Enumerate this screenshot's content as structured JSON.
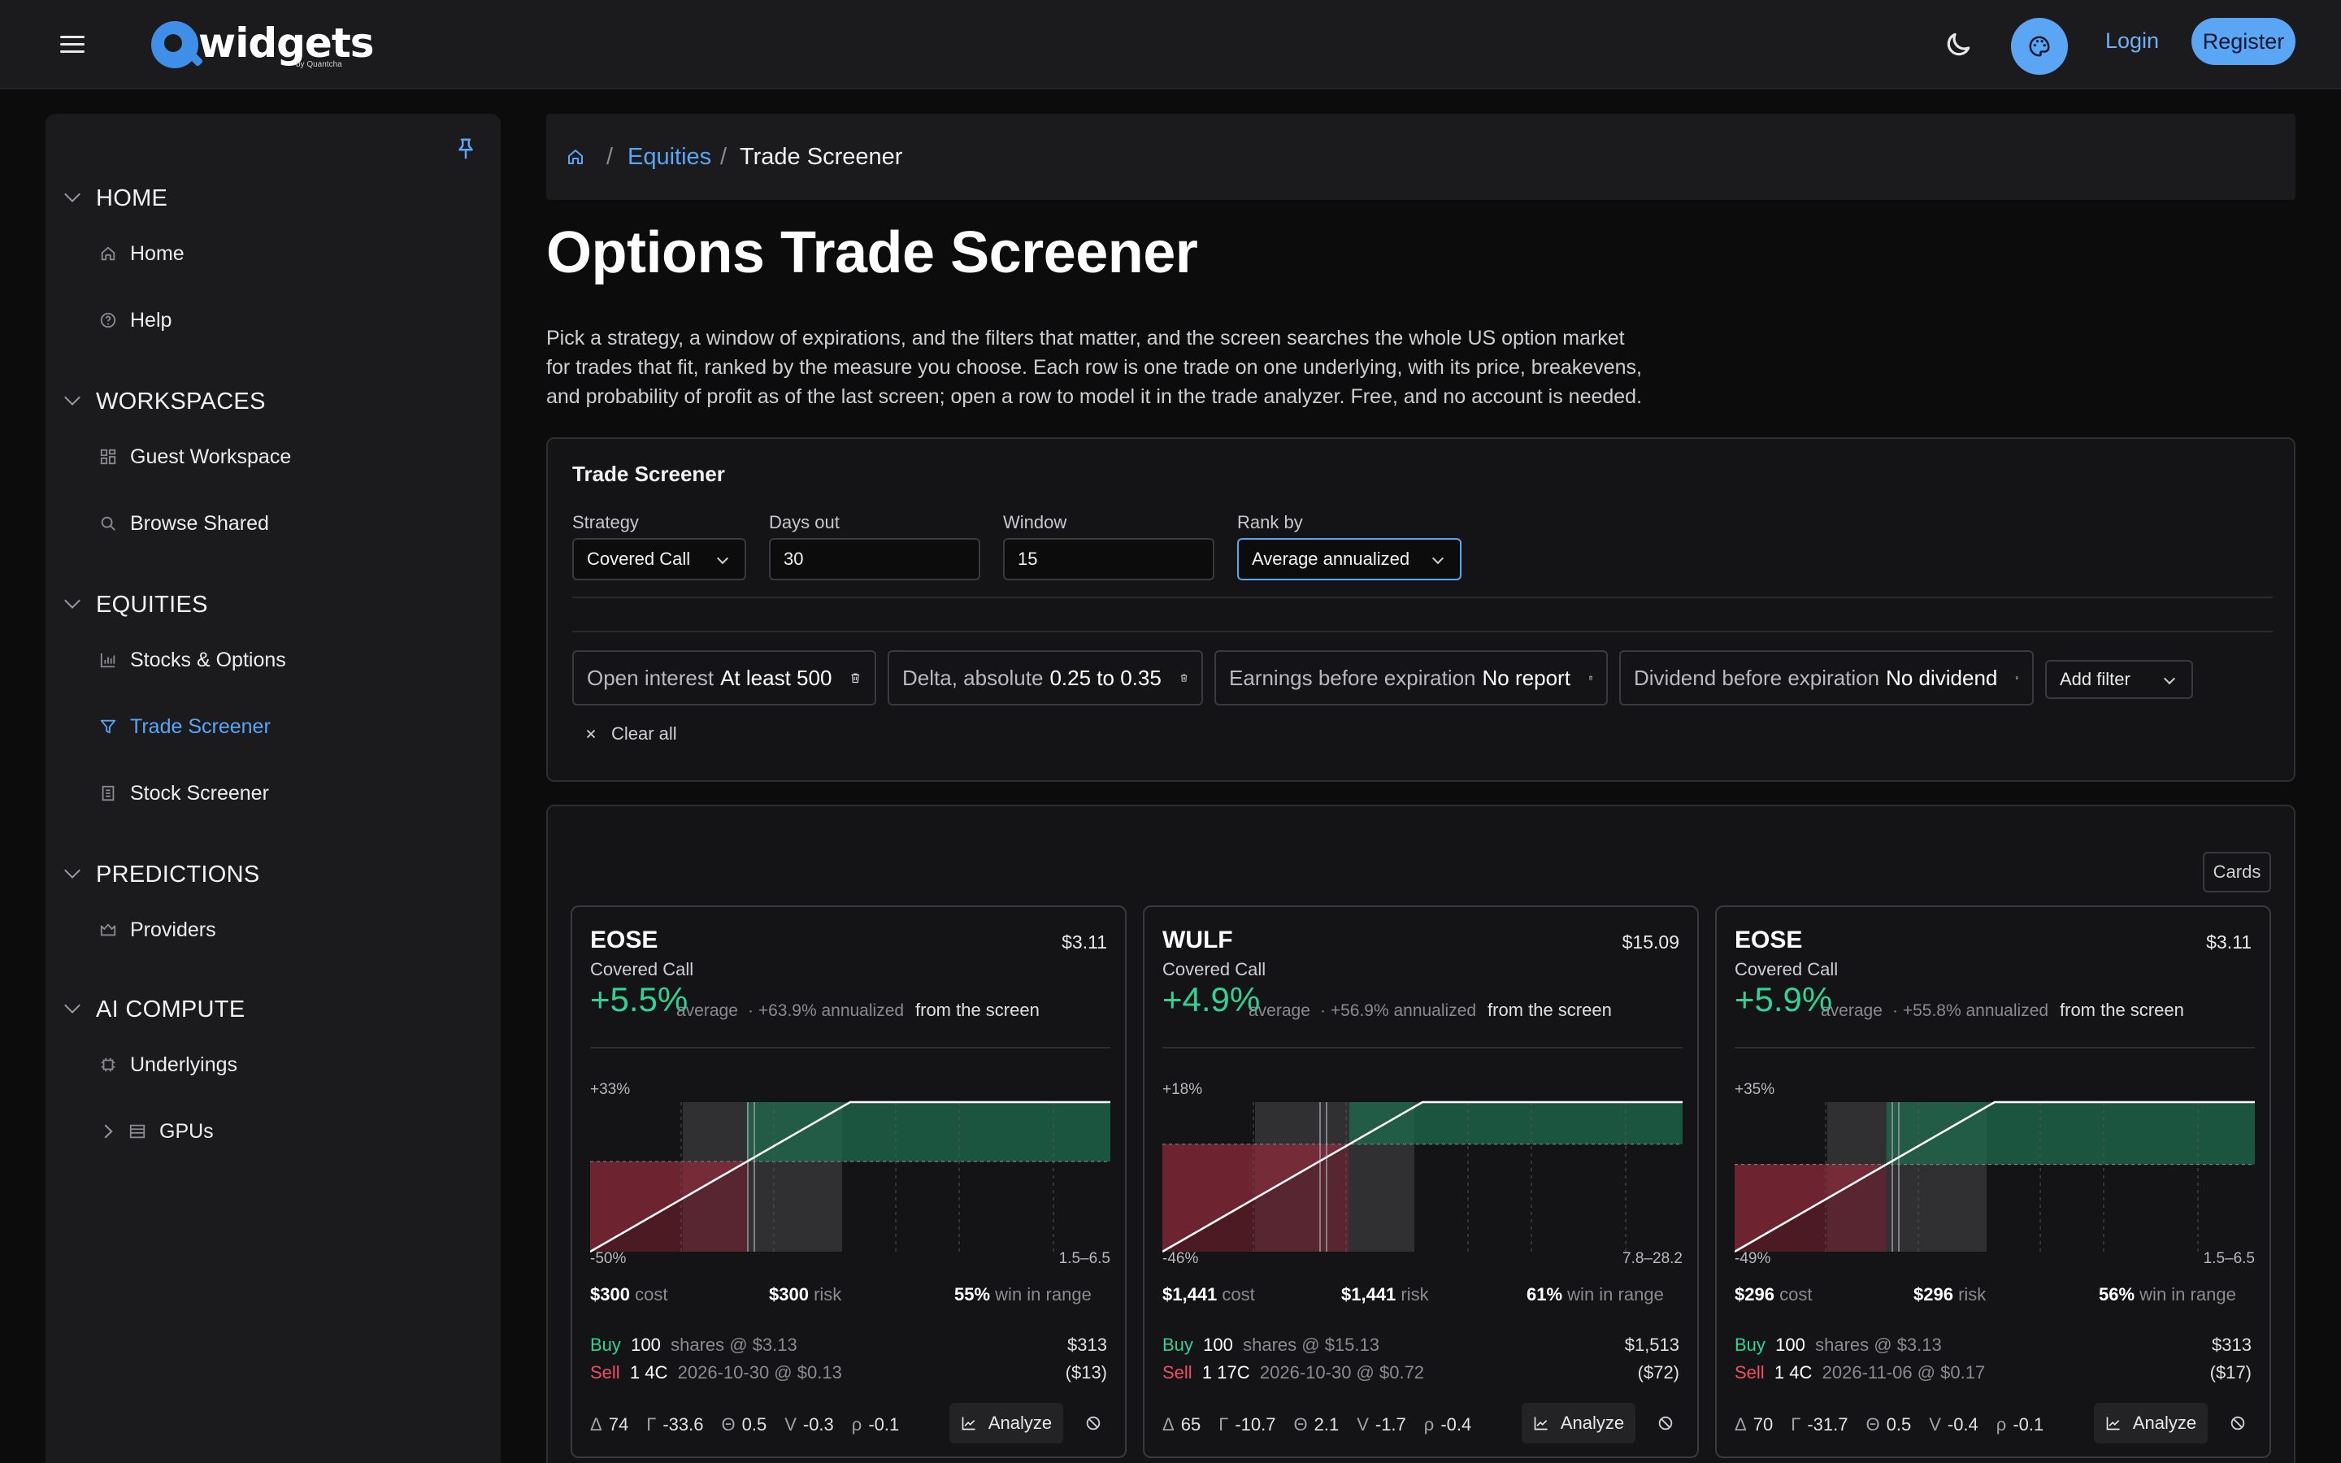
{
  "header": {
    "logo_text": "widgets",
    "logo_sub": "by Quantcha",
    "login": "Login",
    "register": "Register"
  },
  "sidebar": {
    "sections": [
      {
        "label": "HOME",
        "items": [
          {
            "label": "Home",
            "icon": "home-icon"
          },
          {
            "label": "Help",
            "icon": "help-icon"
          }
        ]
      },
      {
        "label": "WORKSPACES",
        "items": [
          {
            "label": "Guest Workspace",
            "icon": "workspace-icon"
          },
          {
            "label": "Browse Shared",
            "icon": "search-icon"
          }
        ]
      },
      {
        "label": "EQUITIES",
        "items": [
          {
            "label": "Stocks & Options",
            "icon": "bar-chart-icon"
          },
          {
            "label": "Trade Screener",
            "icon": "filter-icon",
            "active": true
          },
          {
            "label": "Stock Screener",
            "icon": "list-icon"
          }
        ]
      },
      {
        "label": "PREDICTIONS",
        "items": [
          {
            "label": "Providers",
            "icon": "crown-icon"
          }
        ]
      },
      {
        "label": "AI COMPUTE",
        "items": [
          {
            "label": "Underlyings",
            "icon": "chip-icon"
          },
          {
            "label": "GPUs",
            "icon": "server-icon"
          }
        ]
      }
    ]
  },
  "breadcrumb": {
    "section": "Equities",
    "current": "Trade Screener"
  },
  "page": {
    "title": "Options Trade Screener",
    "description": "Pick a strategy, a window of expirations, and the filters that matter, and the screen searches the whole US option market for trades that fit, ranked by the measure you choose. Each row is one trade on one underlying, with its price, breakevens, and probability of profit as of the last screen; open a row to model it in the trade analyzer. Free, and no account is needed."
  },
  "screener": {
    "title": "Trade Screener",
    "strategy": {
      "label": "Strategy",
      "value": "Covered Call"
    },
    "days_out": {
      "label": "Days out",
      "value": "30"
    },
    "window": {
      "label": "Window",
      "value": "15"
    },
    "rank_by": {
      "label": "Rank by",
      "value": "Average annualized"
    },
    "filters": [
      {
        "key": "Open interest",
        "value": "At least 500"
      },
      {
        "key": "Delta, absolute",
        "value": "0.25 to 0.35"
      },
      {
        "key": "Earnings before expiration",
        "value": "No report"
      },
      {
        "key": "Dividend before expiration",
        "value": "No dividend"
      }
    ],
    "add_filter": "Add filter",
    "clear_all": "Clear all"
  },
  "results": {
    "view_toggle": "Cards",
    "colors": {
      "profit": "#30d394",
      "loss": "#ef4f66",
      "accent": "#5aa6f5"
    },
    "cards": [
      {
        "ticker": "EOSE",
        "price": "$3.11",
        "strategy": "Covered Call",
        "return": "+5.5%",
        "average": "average",
        "annualized": "· +63.9% annualized",
        "from": "from the screen",
        "chart_top": "+33%",
        "chart_bottom": "-50%",
        "chart_range": "1.5–6.5",
        "payoff": {
          "max_profit_pct": 33,
          "max_loss_pct": -50
        },
        "cost": "$300",
        "cost_label": "cost",
        "risk": "$300",
        "risk_label": "risk",
        "win": "55%",
        "win_label": "win in range",
        "buy_label": "Buy",
        "buy_qty": "100",
        "buy_desc": "shares @ $3.13",
        "buy_value": "$313",
        "sell_label": "Sell",
        "sell_qty": "1",
        "sell_strike": "4C",
        "sell_desc": "2026-10-30 @ $0.13",
        "sell_value": "($13)",
        "delta_label": "Δ",
        "delta": "74",
        "gamma_label": "Γ",
        "gamma": "-33.6",
        "theta_label": "Θ",
        "theta": "0.5",
        "vega_label": "V",
        "vega": "-0.3",
        "rho_label": "ρ",
        "rho": "-0.1",
        "analyze": "Analyze"
      },
      {
        "ticker": "WULF",
        "price": "$15.09",
        "strategy": "Covered Call",
        "return": "+4.9%",
        "average": "average",
        "annualized": "· +56.9% annualized",
        "from": "from the screen",
        "chart_top": "+18%",
        "chart_bottom": "-46%",
        "chart_range": "7.8–28.2",
        "payoff": {
          "max_profit_pct": 18,
          "max_loss_pct": -46
        },
        "cost": "$1,441",
        "cost_label": "cost",
        "risk": "$1,441",
        "risk_label": "risk",
        "win": "61%",
        "win_label": "win in range",
        "buy_label": "Buy",
        "buy_qty": "100",
        "buy_desc": "shares @ $15.13",
        "buy_value": "$1,513",
        "sell_label": "Sell",
        "sell_qty": "1",
        "sell_strike": "17C",
        "sell_desc": "2026-10-30 @ $0.72",
        "sell_value": "($72)",
        "delta_label": "Δ",
        "delta": "65",
        "gamma_label": "Γ",
        "gamma": "-10.7",
        "theta_label": "Θ",
        "theta": "2.1",
        "vega_label": "V",
        "vega": "-1.7",
        "rho_label": "ρ",
        "rho": "-0.4",
        "analyze": "Analyze"
      },
      {
        "ticker": "EOSE",
        "price": "$3.11",
        "strategy": "Covered Call",
        "return": "+5.9%",
        "average": "average",
        "annualized": "· +55.8% annualized",
        "from": "from the screen",
        "chart_top": "+35%",
        "chart_bottom": "-49%",
        "chart_range": "1.5–6.5",
        "payoff": {
          "max_profit_pct": 35,
          "max_loss_pct": -49
        },
        "cost": "$296",
        "cost_label": "cost",
        "risk": "$296",
        "risk_label": "risk",
        "win": "56%",
        "win_label": "win in range",
        "buy_label": "Buy",
        "buy_qty": "100",
        "buy_desc": "shares @ $3.13",
        "buy_value": "$313",
        "sell_label": "Sell",
        "sell_qty": "1",
        "sell_strike": "4C",
        "sell_desc": "2026-11-06 @ $0.17",
        "sell_value": "($17)",
        "delta_label": "Δ",
        "delta": "70",
        "gamma_label": "Γ",
        "gamma": "-31.7",
        "theta_label": "Θ",
        "theta": "0.5",
        "vega_label": "V",
        "vega": "-0.4",
        "rho_label": "ρ",
        "rho": "-0.1",
        "analyze": "Analyze"
      }
    ]
  }
}
